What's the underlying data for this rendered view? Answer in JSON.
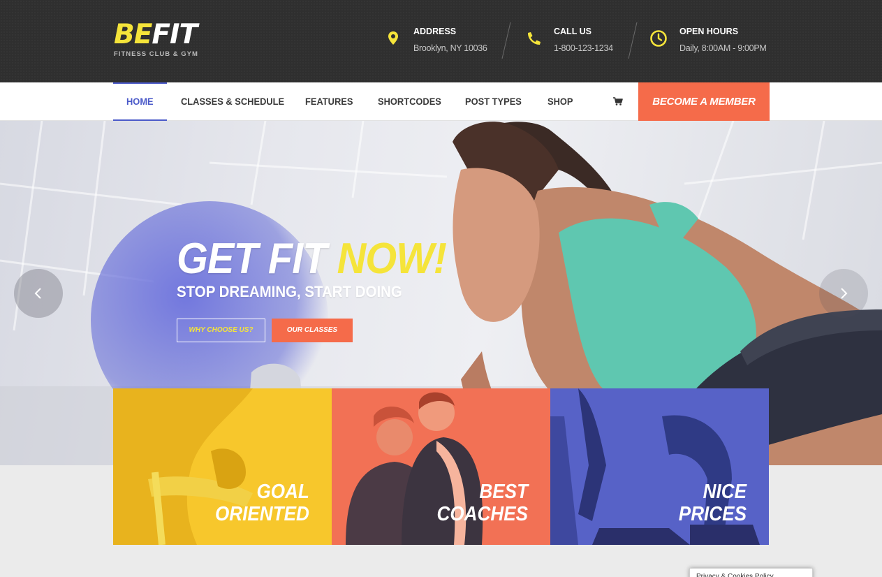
{
  "brand": {
    "name_part1": "BE",
    "name_part2": "FIT",
    "tagline": "FITNESS CLUB & GYM",
    "accent_color": "#f5e43a"
  },
  "contact": [
    {
      "icon": "map-pin-icon",
      "title": "ADDRESS",
      "text": "Brooklyn, NY 10036"
    },
    {
      "icon": "phone-icon",
      "title": "CALL US",
      "text": "1-800-123-1234"
    },
    {
      "icon": "clock-icon",
      "title": "OPEN HOURS",
      "text": "Daily, 8:00AM - 9:00PM"
    }
  ],
  "nav": {
    "items": [
      {
        "label": "HOME",
        "active": true
      },
      {
        "label": "CLASSES & SCHEDULE"
      },
      {
        "label": "FEATURES"
      },
      {
        "label": "SHORTCODES"
      },
      {
        "label": "POST TYPES"
      },
      {
        "label": "SHOP"
      }
    ],
    "cart_icon": "cart-icon",
    "cta_label": "BECOME A MEMBER",
    "active_color": "#4b5ac9",
    "cta_color": "#f56b4a"
  },
  "hero": {
    "title_white": "GET FIT ",
    "title_yellow": "NOW!",
    "subtitle": "STOP DREAMING, START DOING",
    "button_primary": "WHY CHOOSE US?",
    "button_secondary": "OUR CLASSES",
    "prev_icon": "chevron-left-icon",
    "next_icon": "chevron-right-icon"
  },
  "features": [
    {
      "line1": "GOAL",
      "line2": "ORIENTED",
      "color": "#f7c72c"
    },
    {
      "line1": "BEST",
      "line2": "COACHES",
      "color": "#f27155"
    },
    {
      "line1": "NICE",
      "line2": "PRICES",
      "color": "#5762c7"
    }
  ],
  "cookie": {
    "label": "Privacy & Cookies Policy"
  }
}
